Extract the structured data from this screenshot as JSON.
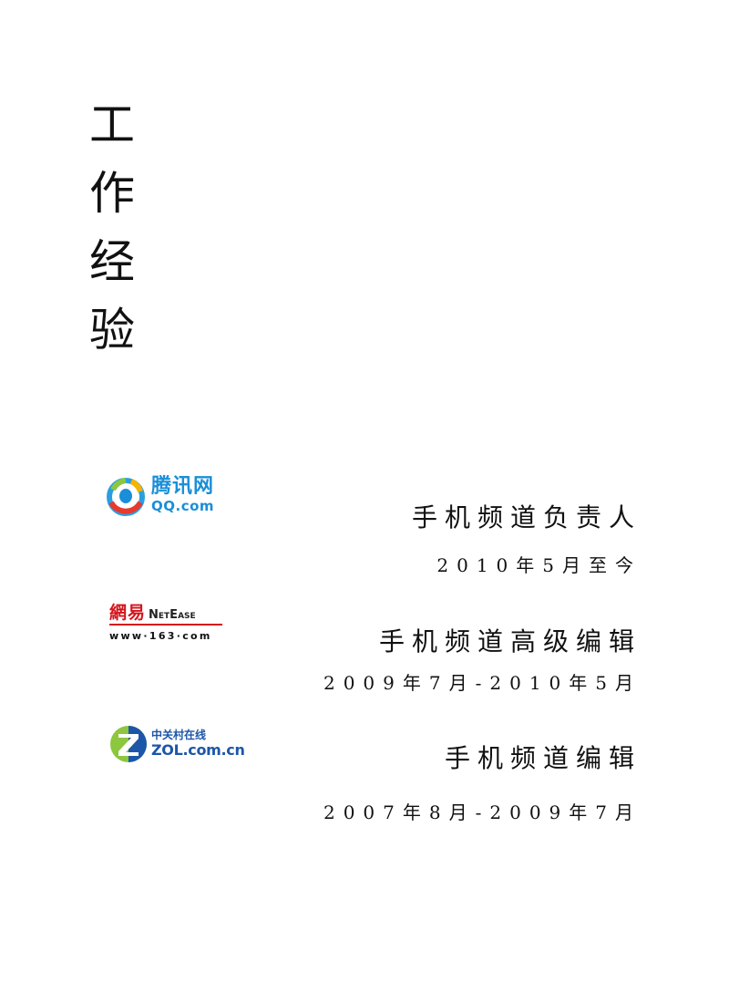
{
  "title": {
    "chars": [
      "工",
      "作",
      "经",
      "验"
    ]
  },
  "entries": [
    {
      "company": "tencent",
      "logo": {
        "name_cn": "腾讯网",
        "name_en": "QQ.com"
      },
      "role": "手机频道负责人",
      "period": "2010年5月至今"
    },
    {
      "company": "netease",
      "logo": {
        "name_cn": "網易",
        "name_en": "NetEase",
        "url": "www·163·com"
      },
      "role": "手机频道高级编辑",
      "period": "2009年7月-2010年5月"
    },
    {
      "company": "zol",
      "logo": {
        "name_cn": "中关村在线",
        "name_en": "ZOL.com.cn"
      },
      "role": "手机频道编辑",
      "period": "2007年8月-2009年7月"
    }
  ],
  "colors": {
    "text": "#111111",
    "qq_blue": "#1a8fd8",
    "netease_red": "#d4141b",
    "zol_blue": "#1d56a8",
    "zol_green": "#8dc63f"
  }
}
